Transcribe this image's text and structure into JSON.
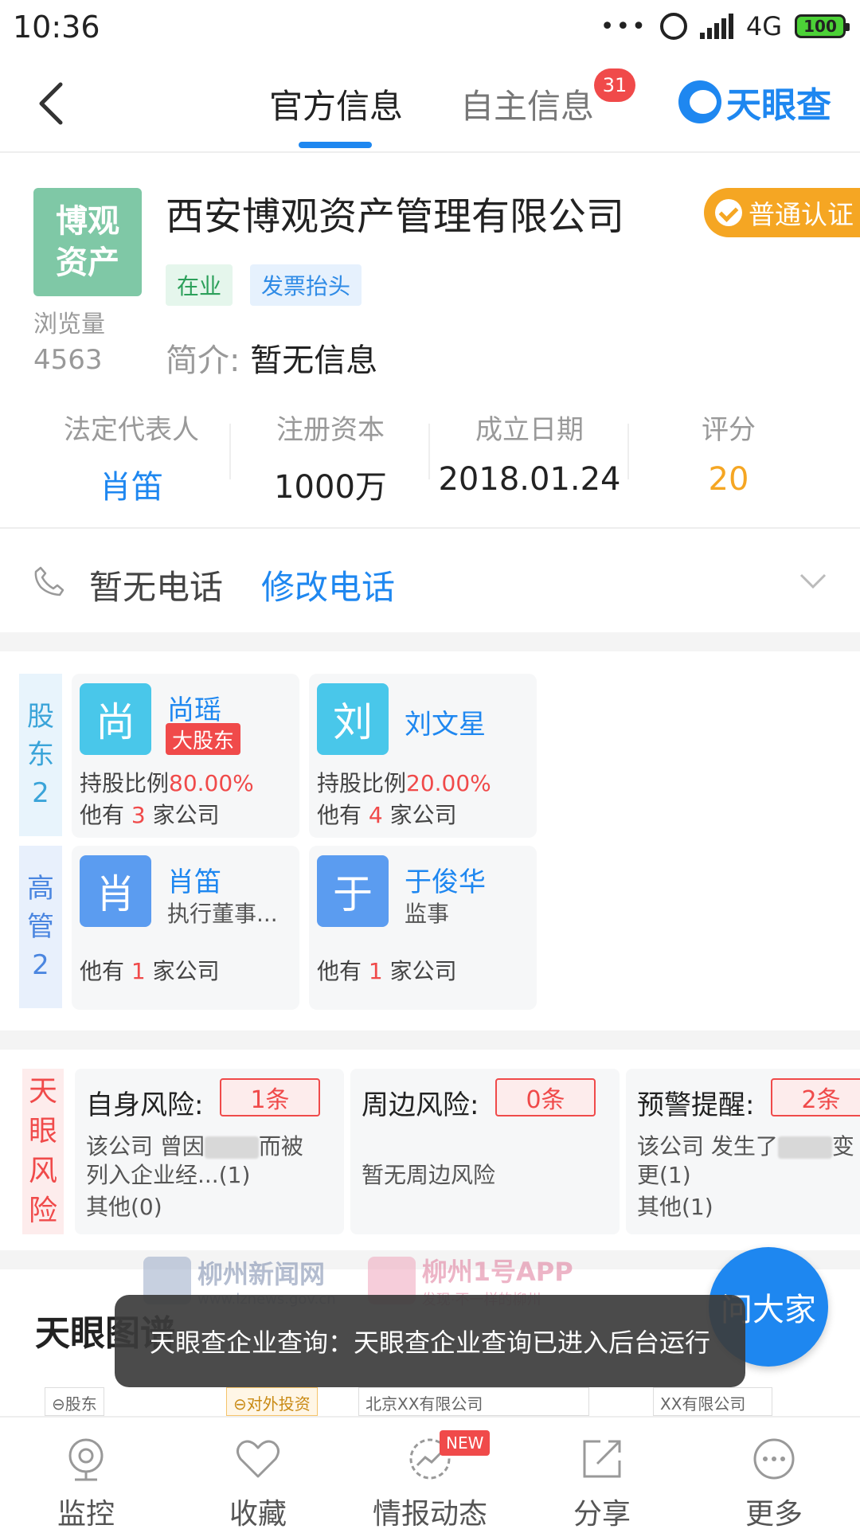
{
  "status_bar": {
    "time": "10:36",
    "dots": "•••",
    "network": "4G",
    "battery": "100"
  },
  "header": {
    "tabs": [
      {
        "label": "官方信息"
      },
      {
        "label": "自主信息"
      }
    ],
    "self_info_badge": "31",
    "brand": "天眼查"
  },
  "company": {
    "logo_text_line1": "博观",
    "logo_text_line2": "资产",
    "views_label": "浏览量",
    "views_count": "4563",
    "name": "西安博观资产管理有限公司",
    "certification": "普通认证",
    "tags": [
      "在业",
      "发票抬头"
    ],
    "intro_label": "简介:",
    "intro_value": "暂无信息",
    "stats": [
      {
        "label": "法定代表人",
        "value": "肖笛"
      },
      {
        "label": "注册资本",
        "value": "1000万"
      },
      {
        "label": "成立日期",
        "value": "2018.01.24"
      },
      {
        "label": "评分",
        "value": "20"
      }
    ]
  },
  "phone": {
    "text": "暂无电话",
    "edit": "修改电话"
  },
  "shareholders": {
    "side_label": [
      "股",
      "东",
      "2"
    ],
    "items": [
      {
        "avatar": "尚",
        "name": "尚瑶",
        "badge": "大股东",
        "ratio_label": "持股比例",
        "ratio": "80.00%",
        "company_prefix": "他有",
        "company_count": "3",
        "company_suffix": "家公司"
      },
      {
        "avatar": "刘",
        "name": "刘文星",
        "ratio_label": "持股比例",
        "ratio": "20.00%",
        "company_prefix": "他有",
        "company_count": "4",
        "company_suffix": "家公司"
      }
    ]
  },
  "executives": {
    "side_label": [
      "高",
      "管",
      "2"
    ],
    "items": [
      {
        "avatar": "肖",
        "name": "肖笛",
        "role": "执行董事...",
        "company_prefix": "他有",
        "company_count": "1",
        "company_suffix": "家公司"
      },
      {
        "avatar": "于",
        "name": "于俊华",
        "role": "监事",
        "company_prefix": "他有",
        "company_count": "1",
        "company_suffix": "家公司"
      }
    ]
  },
  "risk": {
    "side_label": [
      "天",
      "眼",
      "风",
      "险"
    ],
    "cards": [
      {
        "title": "自身风险:",
        "count": "1条",
        "line1a": "该公司 曾因",
        "line1b": "而被",
        "line2": "列入企业经...(1)",
        "line3": "其他(0)"
      },
      {
        "title": "周边风险:",
        "count": "0条",
        "line1": "暂无周边风险"
      },
      {
        "title": "预警提醒:",
        "count": "2条",
        "line1a": "该公司 发生了",
        "line1b": "变",
        "line2": "更(1)",
        "line3": "其他(1)"
      }
    ]
  },
  "graph": {
    "title": "天眼图谱",
    "nodes": [
      "⊖股东",
      "⊖对外投资",
      "北京XX有限公司",
      "XX有限公司"
    ]
  },
  "watermark": {
    "site_name": "柳州新闻网",
    "site_url": "www.lznews.gov.cn",
    "app_name": "柳州1号APP",
    "app_slogan": "发现·不一样的柳州"
  },
  "fab": {
    "label": "问大家"
  },
  "toast": {
    "message": "天眼查企业查询：天眼查企业查询已进入后台运行"
  },
  "bottom_nav": {
    "items": [
      {
        "label": "监控",
        "icon": "monitor-icon"
      },
      {
        "label": "收藏",
        "icon": "heart-icon"
      },
      {
        "label": "情报动态",
        "icon": "trend-icon",
        "badge": "NEW"
      },
      {
        "label": "分享",
        "icon": "share-icon"
      },
      {
        "label": "更多",
        "icon": "more-icon"
      }
    ]
  },
  "colors": {
    "accent": "#1e87f0",
    "red": "#f04a4a",
    "orange": "#f5a623",
    "green": "#2ca05a"
  }
}
